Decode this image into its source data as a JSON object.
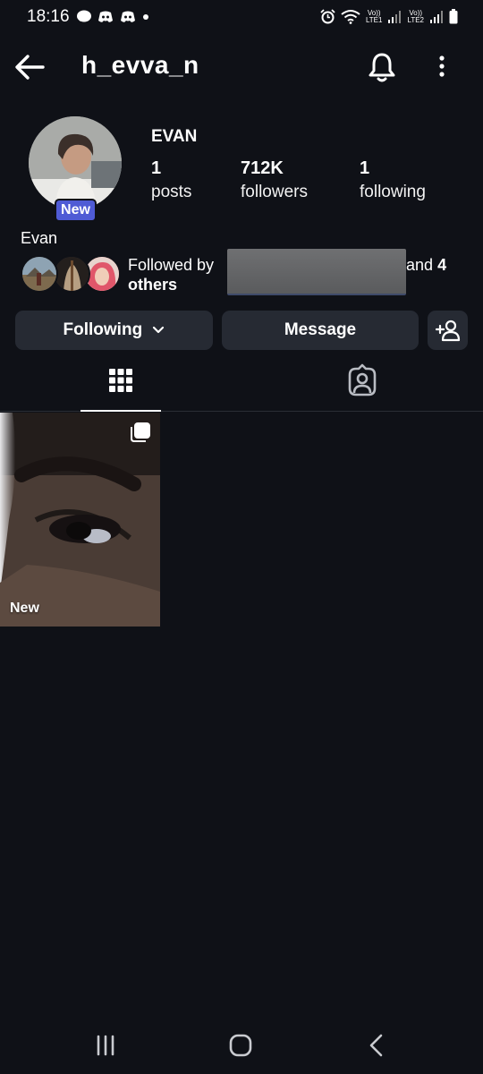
{
  "status_bar": {
    "time": "18:16",
    "net1": "Vo))\nLTE1",
    "net2": "Vo))\nLTE2"
  },
  "header": {
    "username": "h_evva_n"
  },
  "profile": {
    "display_name": "EVAN",
    "new_badge": "New",
    "posts_count": "1",
    "posts_label": "posts",
    "followers_count": "712K",
    "followers_label": "followers",
    "following_count": "1",
    "following_label": "following",
    "bio_name": "Evan",
    "followed_by_prefix": "Followed by",
    "followed_by_suffix": "and",
    "followed_by_count": "4",
    "followed_by_others": "others"
  },
  "buttons": {
    "following": "Following",
    "message": "Message"
  },
  "posts": [
    {
      "label": "New"
    }
  ],
  "colors": {
    "background": "#0f1117",
    "button_bg": "#262a33",
    "badge": "#4f5bd5"
  },
  "icons": [
    "back-arrow-icon",
    "bell-icon",
    "more-vertical-icon",
    "chevron-down-icon",
    "add-person-icon",
    "grid-icon",
    "tagged-person-icon",
    "carousel-icon"
  ]
}
